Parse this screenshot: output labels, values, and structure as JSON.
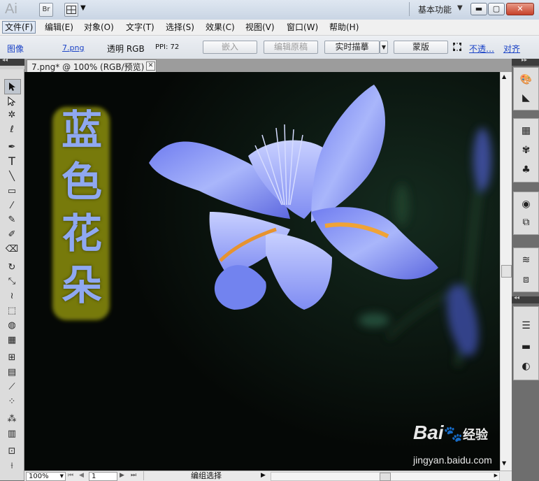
{
  "app": {
    "logo": "Ai",
    "bridge": "Br",
    "workspace_label": "基本功能"
  },
  "colors": {
    "canvas_bg": "#050806",
    "title_text": "#8fa8f0",
    "title_glow": "#8c8f0c",
    "selected_tool": "#bfc6cf"
  },
  "menu": {
    "items": [
      {
        "label": "文件(F)"
      },
      {
        "label": "编辑(E)"
      },
      {
        "label": "对象(O)"
      },
      {
        "label": "文字(T)"
      },
      {
        "label": "选择(S)"
      },
      {
        "label": "效果(C)"
      },
      {
        "label": "视图(V)"
      },
      {
        "label": "窗口(W)"
      },
      {
        "label": "帮助(H)"
      }
    ]
  },
  "control_bar": {
    "image_label": "图像",
    "filename": "7.png",
    "mode": "透明 RGB",
    "ppi": "PPI: 72",
    "embed": "嵌入",
    "edit_original": "编辑原稿",
    "live_trace": "实时描摹",
    "mask": "蒙版",
    "opacity": "不透…",
    "align": "对齐"
  },
  "document": {
    "tab_title": "7.png* @ 100% (RGB/预览)"
  },
  "artwork": {
    "vertical_text": [
      "蓝",
      "色",
      "花",
      "朵"
    ]
  },
  "statusbar": {
    "zoom": "100%",
    "page": "1",
    "status_text": "编组选择"
  },
  "watermark": {
    "brand": "Bai",
    "brand_suffix": "经验",
    "url": "jingyan.baidu.com"
  },
  "icons": {
    "tools": [
      "selection-tool",
      "direct-selection-tool",
      "magic-wand-tool",
      "lasso-tool",
      "pen-tool",
      "type-tool",
      "line-tool",
      "rectangle-tool",
      "paintbrush-tool",
      "pencil-tool",
      "blob-brush-tool",
      "eraser-tool",
      "rotate-tool",
      "scale-tool",
      "warp-tool",
      "free-transform-tool",
      "shape-builder-tool",
      "perspective-grid-tool",
      "mesh-tool",
      "gradient-tool",
      "eyedropper-tool",
      "blend-tool",
      "symbol-sprayer-tool",
      "column-graph-tool",
      "artboard-tool",
      "slice-tool"
    ],
    "panels": [
      "color-icon",
      "color-guide-icon",
      "swatches-icon",
      "brushes-icon",
      "symbols-icon",
      "appearance-icon",
      "graphic-styles-icon",
      "layers-icon",
      "artboards-icon",
      "stroke-icon",
      "gradient-icon",
      "transparency-icon"
    ]
  }
}
